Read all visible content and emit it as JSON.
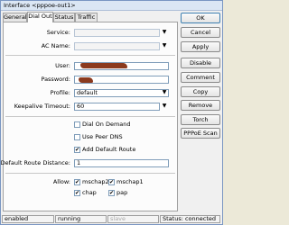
{
  "window": {
    "title": "Interface <pppoe-out1>"
  },
  "tabs": [
    {
      "label": "General",
      "active": false
    },
    {
      "label": "Dial Out",
      "active": true
    },
    {
      "label": "Status",
      "active": false
    },
    {
      "label": "Traffic",
      "active": false
    }
  ],
  "form": {
    "service": {
      "label": "Service:",
      "value": ""
    },
    "ac_name": {
      "label": "AC Name:",
      "value": ""
    },
    "user": {
      "label": "User:"
    },
    "password": {
      "label": "Password:"
    },
    "profile": {
      "label": "Profile:",
      "value": "default"
    },
    "keepalive_timeout": {
      "label": "Keepalive Timeout:",
      "value": "60"
    },
    "dial_on_demand": {
      "label": "Dial On Demand",
      "checked": false
    },
    "use_peer_dns": {
      "label": "Use Peer DNS",
      "checked": false
    },
    "add_default_route": {
      "label": "Add Default Route",
      "checked": true
    },
    "default_route_distance": {
      "label": "Default Route Distance:",
      "value": "1"
    },
    "allow": {
      "label": "Allow:",
      "options": [
        {
          "label": "mschap2",
          "checked": true
        },
        {
          "label": "mschap1",
          "checked": true
        },
        {
          "label": "chap",
          "checked": true
        },
        {
          "label": "pap",
          "checked": true
        }
      ]
    }
  },
  "buttons": {
    "ok": "OK",
    "cancel": "Cancel",
    "apply": "Apply",
    "disable": "Disable",
    "comment": "Comment",
    "copy": "Copy",
    "remove": "Remove",
    "torch": "Torch",
    "pppoe_scan": "PPPoE Scan"
  },
  "statusbar": {
    "enabled": "enabled",
    "running": "running",
    "slave": "slave",
    "status": "Status: connected"
  },
  "icons": {
    "checkmark": "✔",
    "dropdown": "▼",
    "dropdown_alt": "▼"
  }
}
